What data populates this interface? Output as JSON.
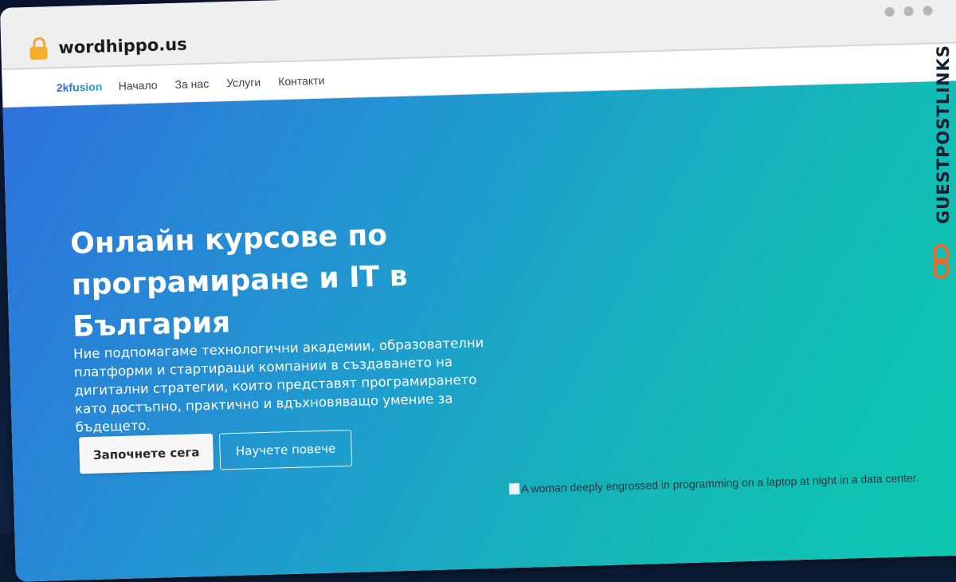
{
  "browser": {
    "url": "wordhippo.us",
    "lock_icon": "lock-icon",
    "window_controls": [
      "dot-icon",
      "dot-icon",
      "dot-icon"
    ]
  },
  "nav": {
    "brand": "2kfusion",
    "links": [
      "Начало",
      "За нас",
      "Услуги",
      "Контакти"
    ]
  },
  "hero": {
    "title": "Онлайн курсове по програмиране и IT в България",
    "text": "Ние подпомагаме технологични академии, образователни платформи и стартиращи компании в създаването на дигитални стратегии, които представят програмирането като достъпно, практично и вдъхновяващо умение за бъдещето.",
    "primary_button": "Започнете сега",
    "secondary_button": "Научете повече",
    "image_alt": "A woman deeply engrossed in programming on a laptop at night in a data center."
  },
  "watermark": {
    "text": "GUESTPOSTLINKS"
  },
  "colors": {
    "hero_start": "#2f72dd",
    "hero_end": "#0ccbb0",
    "lock": "#f6ae2d",
    "watermark_icon": "#e8692c"
  }
}
